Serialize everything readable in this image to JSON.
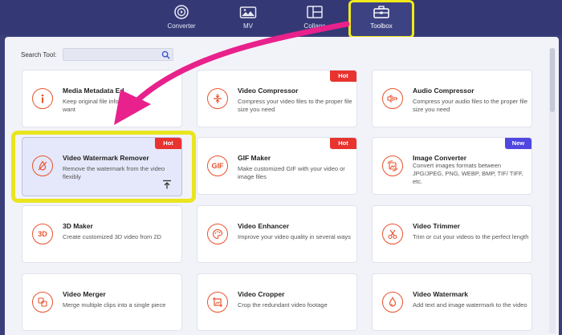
{
  "nav": {
    "tabs": [
      {
        "label": "Converter",
        "icon": "converter-icon"
      },
      {
        "label": "MV",
        "icon": "mv-icon"
      },
      {
        "label": "Collage",
        "icon": "collage-icon"
      },
      {
        "label": "Toolbox",
        "icon": "toolbox-icon",
        "active": true
      }
    ]
  },
  "search": {
    "label": "Search Tool:",
    "placeholder": ""
  },
  "colors": {
    "accent": "#e8532f",
    "hot": "#e8332f",
    "new": "#5047e0",
    "highlight": "#e9e51f",
    "arrow": "#e8218c"
  },
  "tools": [
    {
      "title": "Media Metadata Editor",
      "title_visible": "Media Metadata Ed",
      "desc": "Keep original file info",
      "desc2": "you",
      "desc3": "want",
      "icon": "info-icon"
    },
    {
      "title": "Video Compressor",
      "desc": "Compress your video files to the proper file size you need",
      "badge": "Hot",
      "icon": "compress-icon"
    },
    {
      "title": "Audio Compressor",
      "desc": "Compress your audio files to the proper file size you need",
      "icon": "audio-compress-icon"
    },
    {
      "title": "Video Watermark Remover",
      "desc": "Remove the watermark from the video flexibly",
      "badge": "Hot",
      "icon": "watermark-remove-icon"
    },
    {
      "title": "GIF Maker",
      "desc": "Make customized GIF with your video or image files",
      "badge": "Hot",
      "icon": "gif-icon"
    },
    {
      "title": "Image Converter",
      "desc": "Convert images formats between JPG/JPEG, PNG, WEBP, BMP, TIF/ TIFF, etc.",
      "badge": "New",
      "icon": "image-convert-icon"
    },
    {
      "title": "3D Maker",
      "desc": "Create customized 3D video from 2D",
      "icon": "3d-icon"
    },
    {
      "title": "Video Enhancer",
      "desc": "Improve your video quality in several ways",
      "icon": "palette-icon"
    },
    {
      "title": "Video Trimmer",
      "desc": "Trim or cut your videos to the perfect length",
      "icon": "scissors-icon"
    },
    {
      "title": "Video Merger",
      "desc": "Merge multiple clips into a single piece",
      "icon": "merge-icon"
    },
    {
      "title": "Video Cropper",
      "desc": "Crop the redundant video footage",
      "icon": "crop-icon"
    },
    {
      "title": "Video Watermark",
      "desc": "Add text and image watermark to the video",
      "icon": "droplet-icon"
    }
  ]
}
